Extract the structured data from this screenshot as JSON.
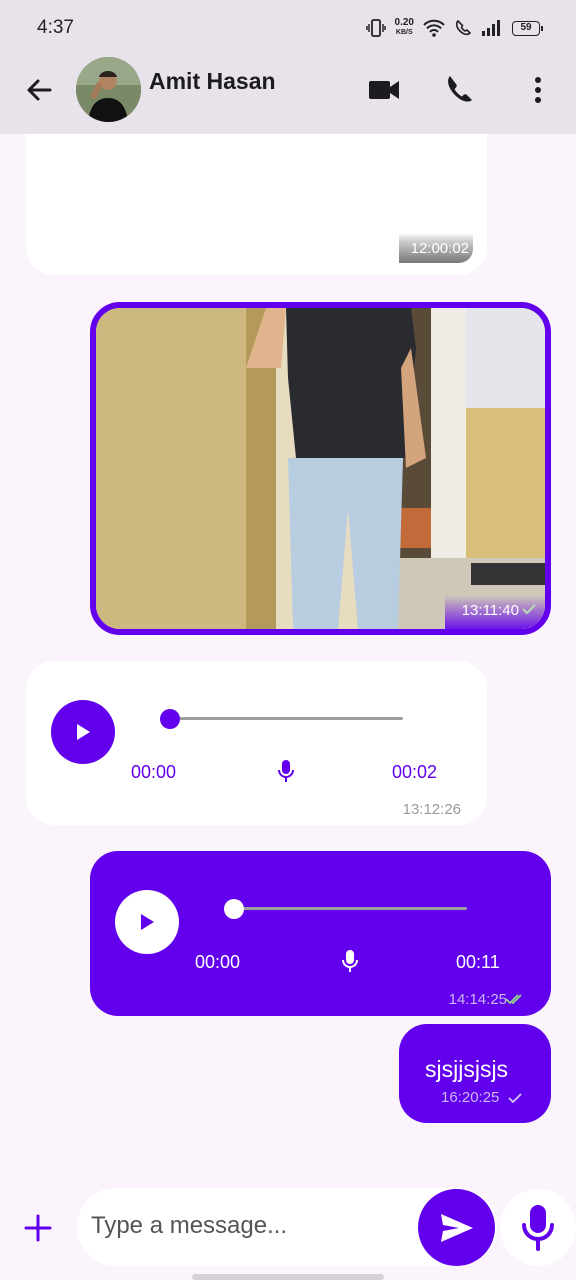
{
  "status_bar": {
    "time": "4:37",
    "net_speed": "0.20",
    "net_unit": "KB/S",
    "battery": "59"
  },
  "header": {
    "contact_name": "Amit Hasan"
  },
  "messages": [
    {
      "kind": "media",
      "direction": "incoming",
      "time": "12:00:02"
    },
    {
      "kind": "image",
      "direction": "outgoing",
      "time": "13:11:40",
      "status": "sent"
    },
    {
      "kind": "audio",
      "direction": "incoming",
      "elapsed": "00:00",
      "duration": "00:02",
      "progress": 0,
      "time": "13:12:26"
    },
    {
      "kind": "audio",
      "direction": "outgoing",
      "elapsed": "00:00",
      "duration": "00:11",
      "progress": 0,
      "time": "14:14:25",
      "status": "delivered"
    },
    {
      "kind": "text",
      "direction": "outgoing",
      "text": "sjsjjsjsjs",
      "time": "16:20:25",
      "status": "sent"
    }
  ],
  "composer": {
    "placeholder": "Type a message..."
  },
  "colors": {
    "accent": "#6200ee",
    "app_bar": "#e8e2ea",
    "background": "#fbf4fd",
    "incoming_bubble": "#ffffff"
  },
  "icons": [
    "back-arrow-icon",
    "video-call-icon",
    "phone-icon",
    "more-vert-icon",
    "play-icon",
    "mic-icon",
    "add-icon",
    "send-icon",
    "check-icon",
    "double-check-icon"
  ]
}
